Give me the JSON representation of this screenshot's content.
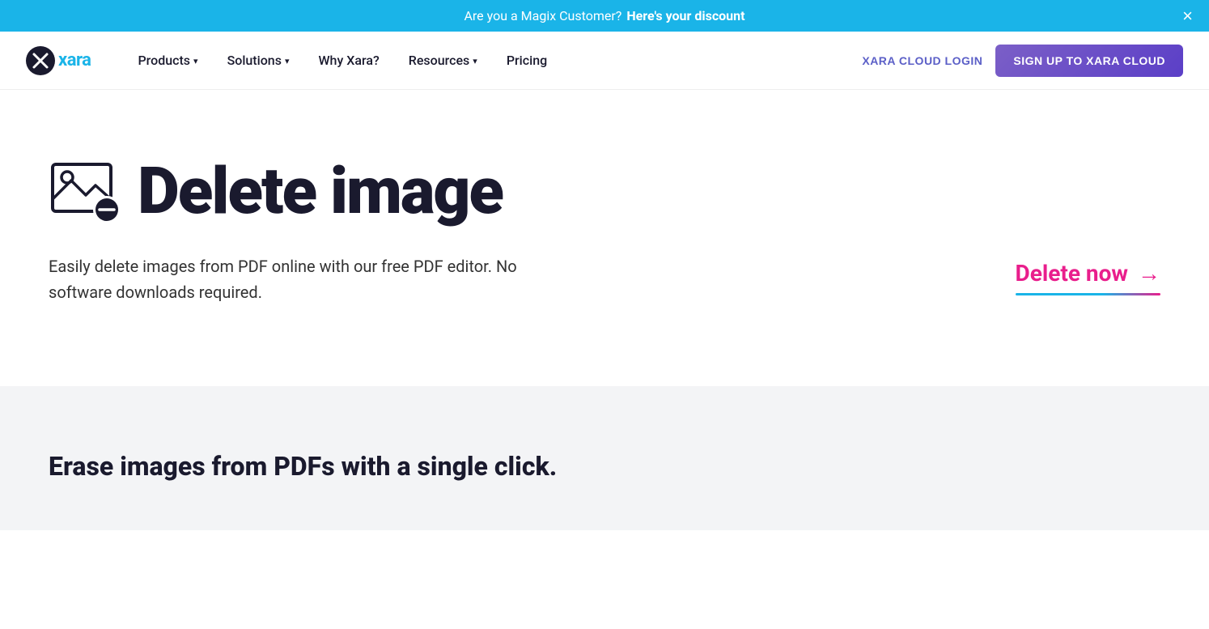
{
  "banner": {
    "text_regular": "Are you a Magix Customer?",
    "text_bold": "Here's your discount",
    "close_label": "×"
  },
  "nav": {
    "logo_symbol": "✕",
    "logo_text": "xara",
    "links": [
      {
        "label": "Products",
        "has_dropdown": true
      },
      {
        "label": "Solutions",
        "has_dropdown": true
      },
      {
        "label": "Why Xara?",
        "has_dropdown": false
      },
      {
        "label": "Resources",
        "has_dropdown": true
      },
      {
        "label": "Pricing",
        "has_dropdown": false
      }
    ],
    "login_label": "XARA CLOUD LOGIN",
    "signup_label": "SIGN UP TO XARA CLOUD"
  },
  "hero": {
    "title": "Delete image",
    "description": "Easily delete images from PDF online with our free PDF editor. No software downloads required.",
    "cta_label": "Delete now",
    "cta_arrow": "→"
  },
  "section": {
    "title": "Erase images from PDFs with a single click."
  }
}
